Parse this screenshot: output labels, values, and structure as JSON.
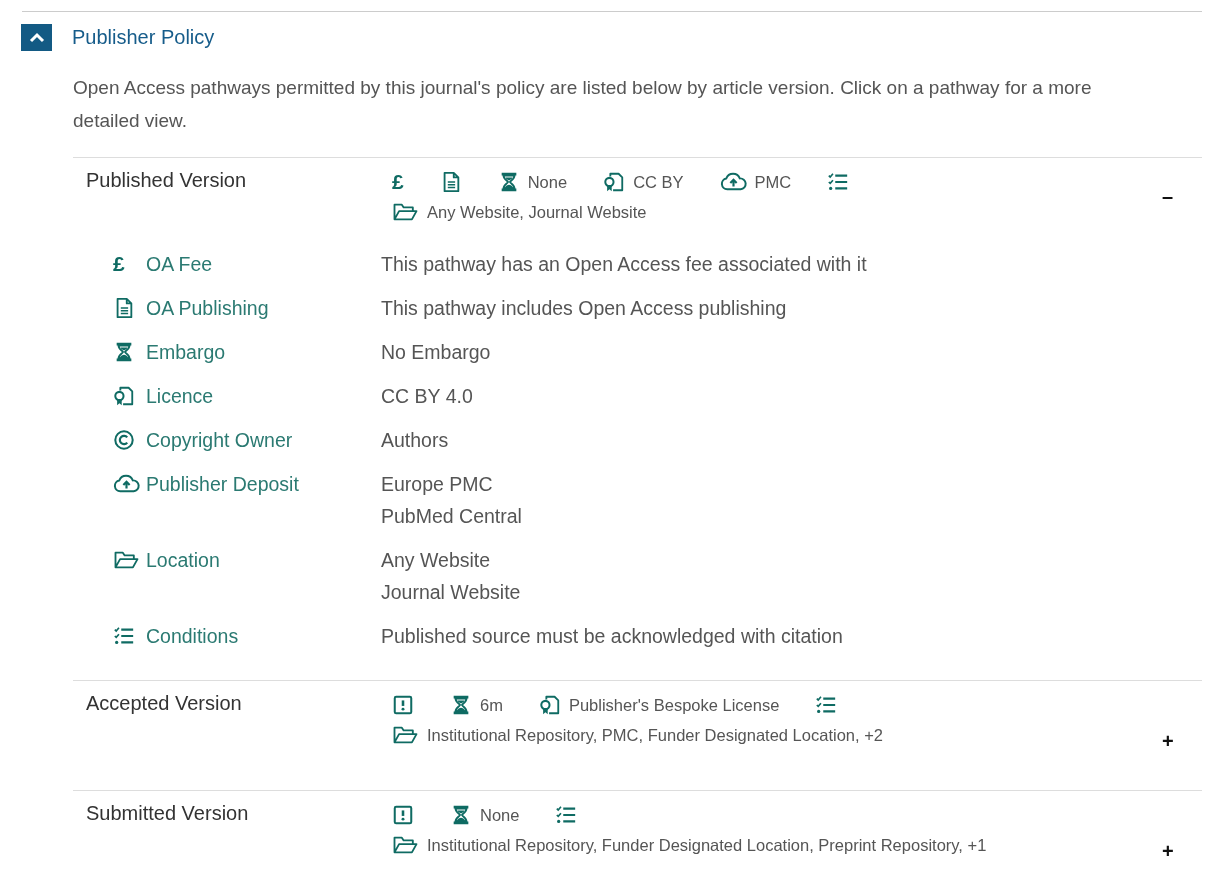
{
  "section": {
    "title": "Publisher Policy",
    "expanded": true,
    "description": "Open Access pathways permitted by this journal's policy are listed below by article version. Click on a pathway for a more detailed view."
  },
  "pathways": [
    {
      "title": "Published Version",
      "expanded": true,
      "toggle": "–",
      "summary": [
        {
          "kind": "fee",
          "symbol": "£"
        },
        {
          "kind": "publishing"
        },
        {
          "kind": "embargo",
          "text": "None"
        },
        {
          "kind": "licence",
          "text": "CC BY"
        },
        {
          "kind": "deposit",
          "text": "PMC"
        },
        {
          "kind": "conditions"
        }
      ],
      "location": "Any Website, Journal Website",
      "details": [
        {
          "kind": "fee",
          "symbol": "£",
          "label": "OA Fee",
          "values": [
            "This pathway has an Open Access fee associated with it"
          ]
        },
        {
          "kind": "publishing",
          "label": "OA Publishing",
          "values": [
            "This pathway includes Open Access publishing"
          ]
        },
        {
          "kind": "embargo",
          "label": "Embargo",
          "values": [
            "No Embargo"
          ]
        },
        {
          "kind": "licence",
          "label": "Licence",
          "values": [
            "CC BY 4.0"
          ]
        },
        {
          "kind": "copyright",
          "label": "Copyright Owner",
          "values": [
            "Authors"
          ]
        },
        {
          "kind": "deposit",
          "label": "Publisher Deposit",
          "values": [
            "Europe PMC",
            "PubMed Central"
          ]
        },
        {
          "kind": "location",
          "label": "Location",
          "values": [
            "Any Website",
            "Journal Website"
          ]
        },
        {
          "kind": "conditions",
          "label": "Conditions",
          "values": [
            "Published source must be acknowledged with citation"
          ]
        }
      ]
    },
    {
      "title": "Accepted Version",
      "expanded": false,
      "toggle": "+",
      "summary": [
        {
          "kind": "notice"
        },
        {
          "kind": "embargo",
          "text": "6m"
        },
        {
          "kind": "licence",
          "text": "Publisher's Bespoke License"
        },
        {
          "kind": "conditions"
        }
      ],
      "location": "Institutional Repository, PMC, Funder Designated Location, +2"
    },
    {
      "title": "Submitted Version",
      "expanded": false,
      "toggle": "+",
      "summary": [
        {
          "kind": "notice"
        },
        {
          "kind": "embargo",
          "text": "None"
        },
        {
          "kind": "conditions"
        }
      ],
      "location": "Institutional Repository, Funder Designated Location, Preprint Repository, +1"
    }
  ]
}
